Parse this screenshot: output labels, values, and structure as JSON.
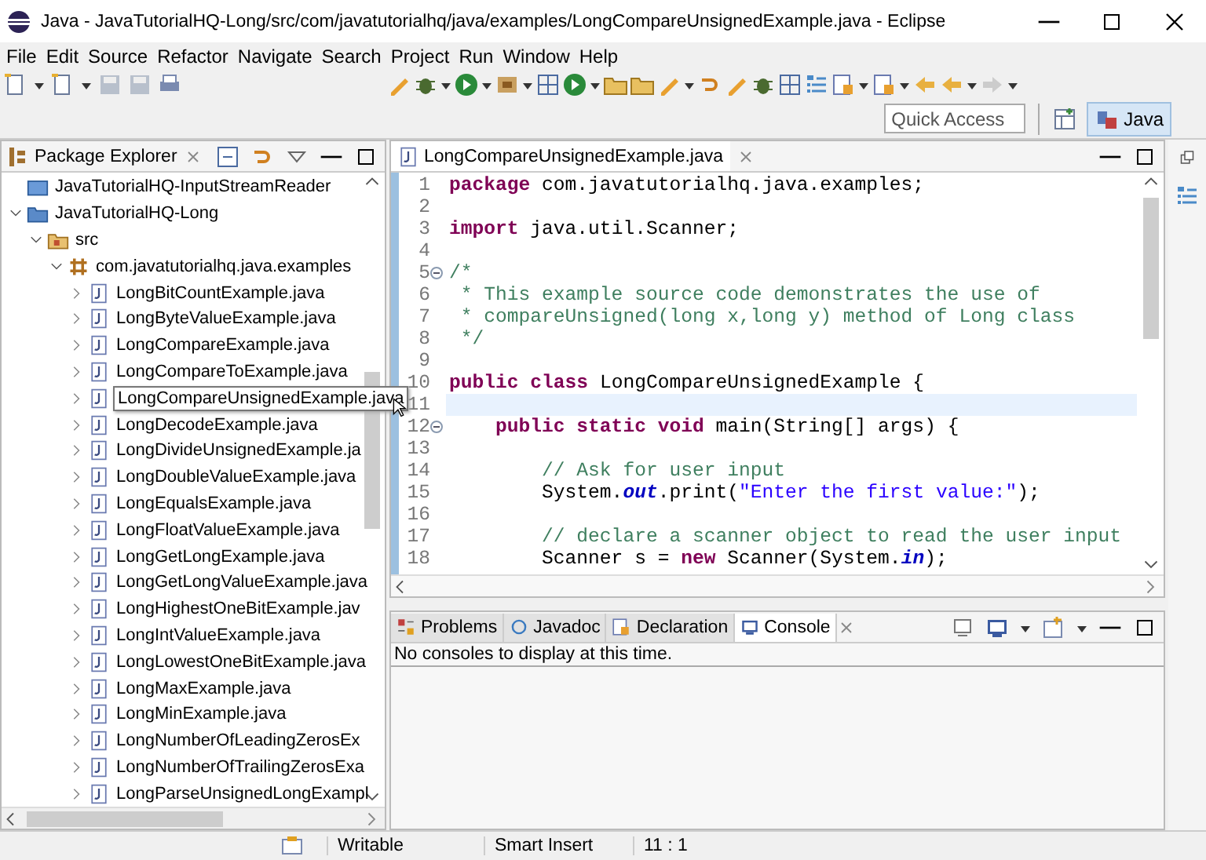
{
  "window": {
    "title": "Java - JavaTutorialHQ-Long/src/com/javatutorialhq/java/examples/LongCompareUnsignedExample.java - Eclipse"
  },
  "menu": [
    "File",
    "Edit",
    "Source",
    "Refactor",
    "Navigate",
    "Search",
    "Project",
    "Run",
    "Window",
    "Help"
  ],
  "quick_access": {
    "placeholder": "Quick Access"
  },
  "perspective": {
    "label": "Java",
    "selected": true
  },
  "package_explorer": {
    "title": "Package Explorer",
    "tree": [
      {
        "kind": "closed-project",
        "label": "JavaTutorialHQ-InputStreamReader"
      },
      {
        "kind": "project",
        "label": "JavaTutorialHQ-Long",
        "expanded": true,
        "children": [
          {
            "kind": "folder",
            "label": "src",
            "expanded": true,
            "children": [
              {
                "kind": "package",
                "label": "com.javatutorialhq.java.examples",
                "expanded": true,
                "children": [
                  {
                    "kind": "file",
                    "label": "LongBitCountExample.java",
                    "expanded": false,
                    "hovered": false
                  },
                  {
                    "kind": "file",
                    "label": "LongByteValueExample.java",
                    "expanded": false,
                    "hovered": false
                  },
                  {
                    "kind": "file",
                    "label": "LongCompareExample.java",
                    "expanded": false,
                    "hovered": false
                  },
                  {
                    "kind": "file",
                    "label": "LongCompareToExample.java",
                    "expanded": false,
                    "hovered": false
                  },
                  {
                    "kind": "file",
                    "label": "LongCompareUnsignedExample.java",
                    "expanded": false,
                    "hovered": true
                  },
                  {
                    "kind": "file",
                    "label": "LongDecodeExample.java",
                    "expanded": false,
                    "hovered": false
                  },
                  {
                    "kind": "file",
                    "label": "LongDivideUnsignedExample.ja",
                    "expanded": false,
                    "hovered": false
                  },
                  {
                    "kind": "file",
                    "label": "LongDoubleValueExample.java",
                    "expanded": false,
                    "hovered": false
                  },
                  {
                    "kind": "file",
                    "label": "LongEqualsExample.java",
                    "expanded": false,
                    "hovered": false
                  },
                  {
                    "kind": "file",
                    "label": "LongFloatValueExample.java",
                    "expanded": false,
                    "hovered": false
                  },
                  {
                    "kind": "file",
                    "label": "LongGetLongExample.java",
                    "expanded": false,
                    "hovered": false
                  },
                  {
                    "kind": "file",
                    "label": "LongGetLongValueExample.java",
                    "expanded": false,
                    "hovered": false
                  },
                  {
                    "kind": "file",
                    "label": "LongHighestOneBitExample.jav",
                    "expanded": false,
                    "hovered": false
                  },
                  {
                    "kind": "file",
                    "label": "LongIntValueExample.java",
                    "expanded": false,
                    "hovered": false
                  },
                  {
                    "kind": "file",
                    "label": "LongLowestOneBitExample.java",
                    "expanded": false,
                    "hovered": false
                  },
                  {
                    "kind": "file",
                    "label": "LongMaxExample.java",
                    "expanded": false,
                    "hovered": false
                  },
                  {
                    "kind": "file",
                    "label": "LongMinExample.java",
                    "expanded": false,
                    "hovered": false
                  },
                  {
                    "kind": "file",
                    "label": "LongNumberOfLeadingZerosEx",
                    "expanded": false,
                    "hovered": false
                  },
                  {
                    "kind": "file",
                    "label": "LongNumberOfTrailingZerosExa",
                    "expanded": false,
                    "hovered": false
                  },
                  {
                    "kind": "file",
                    "label": "LongParseUnsignedLongExampl",
                    "expanded": false,
                    "hovered": false
                  }
                ]
              }
            ]
          }
        ]
      }
    ]
  },
  "editor": {
    "tab": "LongCompareUnsignedExample.java",
    "lines": [
      {
        "number": "1",
        "current": false,
        "foldable": false,
        "tokens": [
          {
            "kind": "keyword",
            "text": "package"
          },
          {
            "kind": "plain",
            "text": " com.javatutorialhq.java.examples;"
          }
        ]
      },
      {
        "number": "2",
        "current": false,
        "foldable": false
      },
      {
        "number": "3",
        "current": false,
        "foldable": false,
        "tokens": [
          {
            "kind": "keyword",
            "text": "import"
          },
          {
            "kind": "plain",
            "text": " java.util.Scanner;"
          }
        ]
      },
      {
        "number": "4",
        "current": false,
        "foldable": false
      },
      {
        "number": "5",
        "current": false,
        "foldable": true,
        "tokens": [
          {
            "kind": "comment",
            "text": "/*"
          }
        ]
      },
      {
        "number": "6",
        "current": false,
        "foldable": false,
        "tokens": [
          {
            "kind": "comment",
            "text": " * This example source code demonstrates the use of"
          }
        ]
      },
      {
        "number": "7",
        "current": false,
        "foldable": false,
        "tokens": [
          {
            "kind": "comment",
            "text": " * compareUnsigned(long x,long y) method of Long class"
          }
        ]
      },
      {
        "number": "8",
        "current": false,
        "foldable": false,
        "tokens": [
          {
            "kind": "comment",
            "text": " */"
          }
        ]
      },
      {
        "number": "9",
        "current": false,
        "foldable": false
      },
      {
        "number": "10",
        "current": false,
        "foldable": false,
        "tokens": [
          {
            "kind": "keyword",
            "text": "public class"
          },
          {
            "kind": "plain",
            "text": " LongCompareUnsignedExample {"
          }
        ]
      },
      {
        "number": "11",
        "current": true,
        "foldable": false
      },
      {
        "number": "12",
        "current": false,
        "foldable": true,
        "tokens": [
          {
            "kind": "keyword",
            "text": "    public static void"
          },
          {
            "kind": "plain",
            "text": " main(String[] args) {"
          }
        ]
      },
      {
        "number": "13",
        "current": false,
        "foldable": false
      },
      {
        "number": "14",
        "current": false,
        "foldable": false,
        "tokens": [
          {
            "kind": "comment",
            "text": "        // Ask for user input"
          }
        ]
      },
      {
        "number": "15",
        "current": false,
        "foldable": false,
        "tokens": [
          {
            "kind": "plain",
            "text": "        System."
          },
          {
            "kind": "field",
            "text": "out"
          },
          {
            "kind": "plain",
            "text": ".print("
          },
          {
            "kind": "string",
            "text": "\"Enter the first value:\""
          },
          {
            "kind": "plain",
            "text": ");"
          }
        ]
      },
      {
        "number": "16",
        "current": false,
        "foldable": false
      },
      {
        "number": "17",
        "current": false,
        "foldable": false,
        "tokens": [
          {
            "kind": "comment",
            "text": "        // declare a scanner object to read the user input"
          }
        ]
      },
      {
        "number": "18",
        "current": false,
        "foldable": false,
        "tokens": [
          {
            "kind": "plain",
            "text": "        Scanner s = "
          },
          {
            "kind": "keyword",
            "text": "new"
          },
          {
            "kind": "plain",
            "text": " Scanner(System."
          },
          {
            "kind": "field",
            "text": "in"
          },
          {
            "kind": "plain",
            "text": ");"
          }
        ]
      }
    ]
  },
  "bottom_panel": {
    "tabs": [
      {
        "label": "Problems",
        "selected": false
      },
      {
        "label": "Javadoc",
        "selected": false
      },
      {
        "label": "Declaration",
        "selected": false
      },
      {
        "label": "Console",
        "selected": true
      }
    ],
    "message": "No consoles to display at this time."
  },
  "status_bar": {
    "cells": [
      "Writable",
      "Smart Insert",
      "11 : 1"
    ]
  }
}
